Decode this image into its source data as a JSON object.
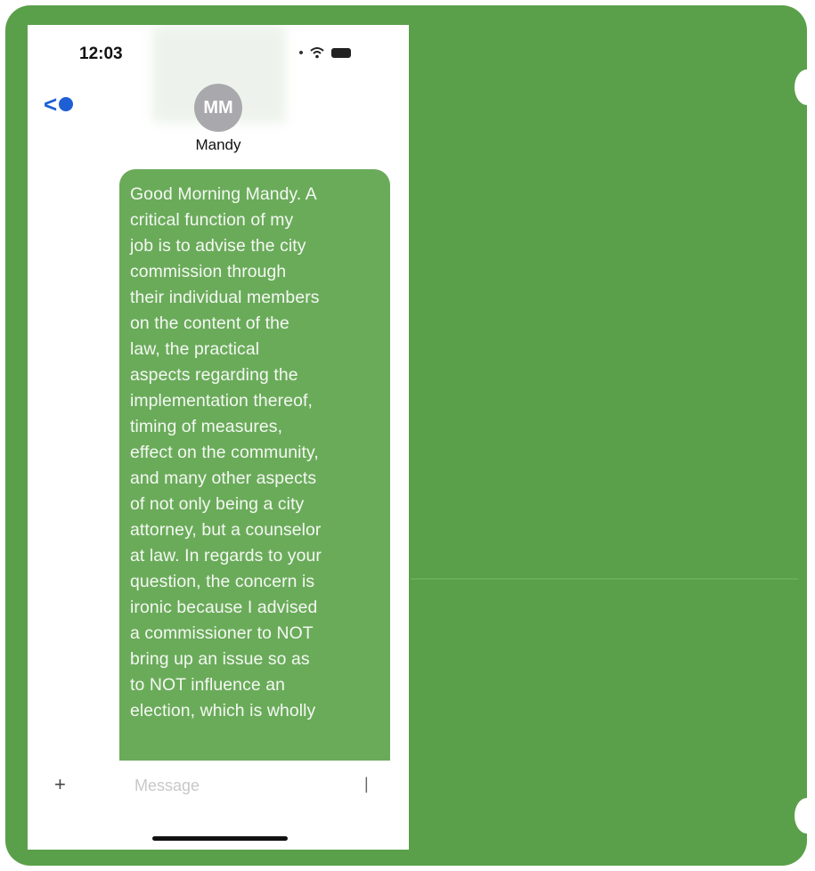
{
  "status_bar": {
    "time": "12:03"
  },
  "header": {
    "back_label": "<",
    "avatar_initials": "MM",
    "contact_name": "Mandy"
  },
  "message": {
    "lines": [
      "Good Morning Mandy. A",
      "critical function of my",
      "job is to advise the city",
      "commission through",
      "their individual members",
      "on the content of the",
      "law, the practical",
      "aspects regarding the",
      "implementation thereof,",
      "timing of measures,",
      "effect on the community,",
      "and many other aspects",
      "of not only being a city",
      "attorney, but a counselor",
      "at law. In regards to your",
      "question, the concern is",
      "ironic because I advised",
      "a commissioner to NOT",
      "bring up an issue so as",
      "to NOT influence an",
      "election, which is wholly"
    ]
  },
  "input": {
    "plus": "+",
    "placeholder": "Message"
  },
  "colors": {
    "background_green": "#5aa04a",
    "bubble_green": "#6aab5a",
    "accent_blue": "#1f5fd6"
  }
}
